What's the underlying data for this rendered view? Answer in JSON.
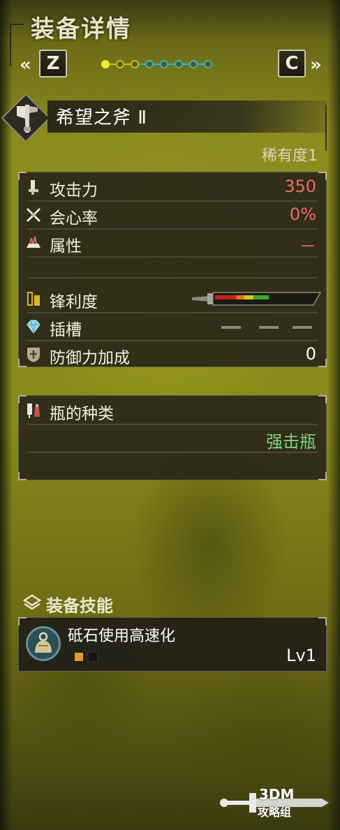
{
  "header": {
    "title": "装备详情"
  },
  "nav": {
    "left_chevron": "«",
    "right_chevron": "»",
    "left_key": "Z",
    "right_key": "C",
    "pages": [
      {
        "color": "yellow",
        "active": true
      },
      {
        "color": "yellow",
        "active": false
      },
      {
        "color": "yellow",
        "active": false
      },
      {
        "color": "cyan",
        "active": false
      },
      {
        "color": "cyan",
        "active": false
      },
      {
        "color": "cyan",
        "active": false
      },
      {
        "color": "cyan",
        "active": false
      },
      {
        "color": "cyan",
        "active": false
      }
    ]
  },
  "weapon": {
    "name": "希望之斧 Ⅱ",
    "rarity": "稀有度1",
    "icon": "switch-axe-icon"
  },
  "stats": {
    "attack": {
      "label": "攻击力",
      "value": "350",
      "color": "#f06a6a"
    },
    "affinity": {
      "label": "会心率",
      "value": "0%",
      "color": "#f06a6a"
    },
    "element": {
      "label": "属性",
      "value": "－",
      "color": "#f06a6a"
    },
    "sharpness": {
      "label": "锋利度",
      "segments": [
        {
          "color": "#c8231d",
          "fraction": 0.22
        },
        {
          "color": "#d97a1c",
          "fraction": 0.08
        },
        {
          "color": "#d8c81d",
          "fraction": 0.1
        },
        {
          "color": "#3ea82e",
          "fraction": 0.16
        }
      ]
    },
    "slots": {
      "label": "插槽",
      "values": [
        "―",
        "―",
        "―"
      ]
    },
    "defense": {
      "label": "防御力加成",
      "value": "0",
      "color": "#ffffff"
    }
  },
  "phial": {
    "label": "瓶的种类",
    "value": "强击瓶",
    "color": "#7fd77a"
  },
  "skills": {
    "title": "装备技能",
    "items": [
      {
        "name": "砥石使用高速化",
        "level": "Lv1",
        "pips_filled": 1,
        "pips_total": 2,
        "icon": "whetstone-icon"
      }
    ]
  },
  "watermark": {
    "line1": "3DM",
    "line2": "攻略组"
  }
}
